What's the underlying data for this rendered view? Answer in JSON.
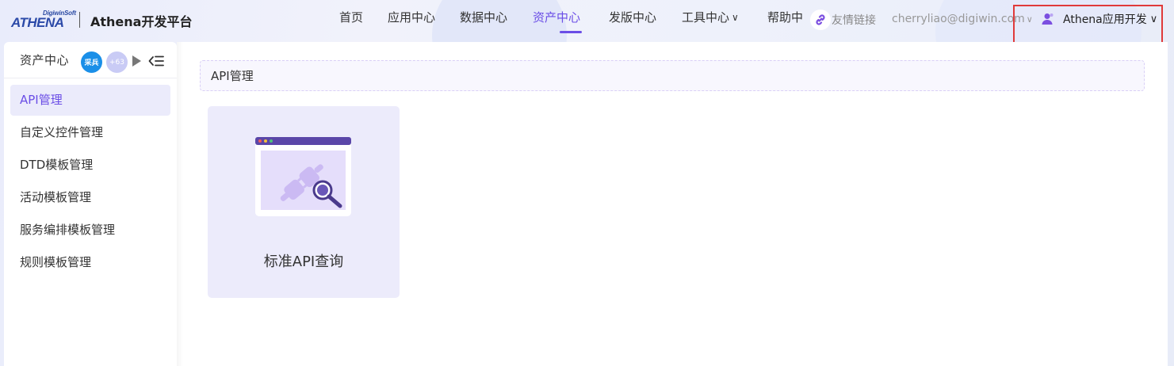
{
  "header": {
    "logo_sub": "DigiwinSoft",
    "logo_main": "ATHENA",
    "app_title": "Athena开发平台",
    "nav": [
      {
        "label": "首页",
        "active": false,
        "dropdown": false
      },
      {
        "label": "应用中心",
        "active": false,
        "dropdown": false
      },
      {
        "label": "数据中心",
        "active": false,
        "dropdown": false
      },
      {
        "label": "资产中心",
        "active": true,
        "dropdown": false
      },
      {
        "label": "发版中心",
        "active": false,
        "dropdown": false
      },
      {
        "label": "工具中心",
        "active": false,
        "dropdown": true
      },
      {
        "label": "帮助中",
        "active": false,
        "dropdown": false
      }
    ],
    "friend_link": "友情链接",
    "email": "cherryliao@digiwin.com",
    "user_name": "Athena应用开发",
    "accent_color": "#6b4ee6",
    "highlight_color": "#e03a3a"
  },
  "sidebar": {
    "title": "资产中心",
    "avatar_1": "采兵",
    "avatar_2": "+63",
    "items": [
      {
        "label": "API管理",
        "active": true
      },
      {
        "label": "自定义控件管理",
        "active": false
      },
      {
        "label": "DTD模板管理",
        "active": false
      },
      {
        "label": "活动模板管理",
        "active": false
      },
      {
        "label": "服务编排模板管理",
        "active": false
      },
      {
        "label": "规则模板管理",
        "active": false
      }
    ]
  },
  "main": {
    "breadcrumb": "API管理",
    "cards": [
      {
        "label": "标准API查询",
        "icon": "plug-search-icon"
      }
    ]
  }
}
